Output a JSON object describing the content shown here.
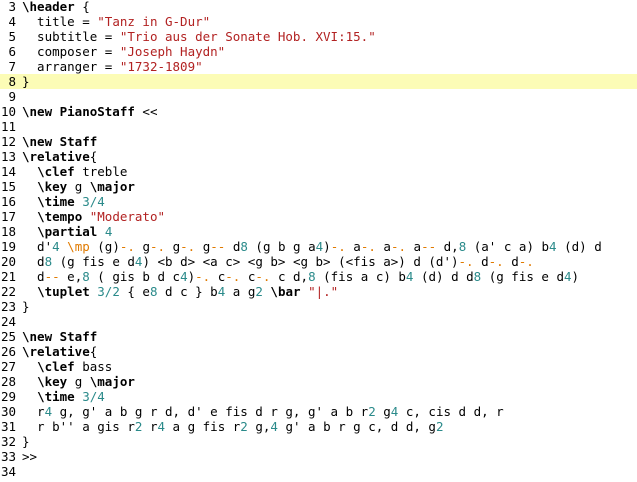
{
  "editor": {
    "lines": [
      {
        "n": "3",
        "current": false,
        "tokens": [
          {
            "t": "kw",
            "v": "\\header"
          },
          {
            "t": "plain",
            "v": " {"
          }
        ]
      },
      {
        "n": "4",
        "current": false,
        "tokens": [
          {
            "t": "plain",
            "v": "  title = "
          },
          {
            "t": "str",
            "v": "\"Tanz in G-Dur\""
          }
        ]
      },
      {
        "n": "5",
        "current": false,
        "tokens": [
          {
            "t": "plain",
            "v": "  subtitle = "
          },
          {
            "t": "str",
            "v": "\"Trio aus der Sonate Hob. XVI:15.\""
          }
        ]
      },
      {
        "n": "6",
        "current": false,
        "tokens": [
          {
            "t": "plain",
            "v": "  composer = "
          },
          {
            "t": "str",
            "v": "\"Joseph Haydn\""
          }
        ]
      },
      {
        "n": "7",
        "current": false,
        "tokens": [
          {
            "t": "plain",
            "v": "  arranger = "
          },
          {
            "t": "str",
            "v": "\"1732-1809\""
          }
        ]
      },
      {
        "n": "8",
        "current": true,
        "tokens": [
          {
            "t": "plain",
            "v": "}"
          }
        ]
      },
      {
        "n": "9",
        "current": false,
        "tokens": []
      },
      {
        "n": "10",
        "current": false,
        "tokens": [
          {
            "t": "kw",
            "v": "\\new PianoStaff"
          },
          {
            "t": "plain",
            "v": " <<"
          }
        ]
      },
      {
        "n": "11",
        "current": false,
        "tokens": []
      },
      {
        "n": "12",
        "current": false,
        "tokens": [
          {
            "t": "kw",
            "v": "\\new Staff"
          }
        ]
      },
      {
        "n": "13",
        "current": false,
        "tokens": [
          {
            "t": "kw",
            "v": "\\relative"
          },
          {
            "t": "plain",
            "v": "{"
          }
        ]
      },
      {
        "n": "14",
        "current": false,
        "tokens": [
          {
            "t": "plain",
            "v": "  "
          },
          {
            "t": "kw",
            "v": "\\clef"
          },
          {
            "t": "plain",
            "v": " treble"
          }
        ]
      },
      {
        "n": "15",
        "current": false,
        "tokens": [
          {
            "t": "plain",
            "v": "  "
          },
          {
            "t": "kw",
            "v": "\\key"
          },
          {
            "t": "plain",
            "v": " g "
          },
          {
            "t": "kw",
            "v": "\\major"
          }
        ]
      },
      {
        "n": "16",
        "current": false,
        "tokens": [
          {
            "t": "plain",
            "v": "  "
          },
          {
            "t": "kw",
            "v": "\\time"
          },
          {
            "t": "plain",
            "v": " "
          },
          {
            "t": "num",
            "v": "3/4"
          }
        ]
      },
      {
        "n": "17",
        "current": false,
        "tokens": [
          {
            "t": "plain",
            "v": "  "
          },
          {
            "t": "kw",
            "v": "\\tempo"
          },
          {
            "t": "plain",
            "v": " "
          },
          {
            "t": "str",
            "v": "\"Moderato\""
          }
        ]
      },
      {
        "n": "18",
        "current": false,
        "tokens": [
          {
            "t": "plain",
            "v": "  "
          },
          {
            "t": "kw",
            "v": "\\partial"
          },
          {
            "t": "plain",
            "v": " "
          },
          {
            "t": "num",
            "v": "4"
          }
        ]
      },
      {
        "n": "19",
        "current": false,
        "tokens": [
          {
            "t": "plain",
            "v": "  d'"
          },
          {
            "t": "dur",
            "v": "4"
          },
          {
            "t": "plain",
            "v": " "
          },
          {
            "t": "dyn",
            "v": "\\mp"
          },
          {
            "t": "plain",
            "v": " (g)"
          },
          {
            "t": "art",
            "v": "-."
          },
          {
            "t": "plain",
            "v": " g"
          },
          {
            "t": "art",
            "v": "-."
          },
          {
            "t": "plain",
            "v": " g"
          },
          {
            "t": "art",
            "v": "-."
          },
          {
            "t": "plain",
            "v": " g"
          },
          {
            "t": "art",
            "v": "--"
          },
          {
            "t": "plain",
            "v": " d"
          },
          {
            "t": "dur",
            "v": "8"
          },
          {
            "t": "plain",
            "v": " (g b g a"
          },
          {
            "t": "dur",
            "v": "4"
          },
          {
            "t": "plain",
            "v": ")"
          },
          {
            "t": "art",
            "v": "-."
          },
          {
            "t": "plain",
            "v": " a"
          },
          {
            "t": "art",
            "v": "-."
          },
          {
            "t": "plain",
            "v": " a"
          },
          {
            "t": "art",
            "v": "-."
          },
          {
            "t": "plain",
            "v": " a"
          },
          {
            "t": "art",
            "v": "--"
          },
          {
            "t": "plain",
            "v": " d,"
          },
          {
            "t": "dur",
            "v": "8"
          },
          {
            "t": "plain",
            "v": " (a' c a) b"
          },
          {
            "t": "dur",
            "v": "4"
          },
          {
            "t": "plain",
            "v": " (d) d"
          }
        ]
      },
      {
        "n": "20",
        "current": false,
        "tokens": [
          {
            "t": "plain",
            "v": "  d"
          },
          {
            "t": "dur",
            "v": "8"
          },
          {
            "t": "plain",
            "v": " (g fis e d"
          },
          {
            "t": "dur",
            "v": "4"
          },
          {
            "t": "plain",
            "v": ") <b d> <a c> <g b> <g b> (<fis a>) d (d')"
          },
          {
            "t": "art",
            "v": "-."
          },
          {
            "t": "plain",
            "v": " d"
          },
          {
            "t": "art",
            "v": "-."
          },
          {
            "t": "plain",
            "v": " d"
          },
          {
            "t": "art",
            "v": "-."
          }
        ]
      },
      {
        "n": "21",
        "current": false,
        "tokens": [
          {
            "t": "plain",
            "v": "  d"
          },
          {
            "t": "art",
            "v": "--"
          },
          {
            "t": "plain",
            "v": " e,"
          },
          {
            "t": "dur",
            "v": "8"
          },
          {
            "t": "plain",
            "v": " ( gis b d c"
          },
          {
            "t": "dur",
            "v": "4"
          },
          {
            "t": "plain",
            "v": ")"
          },
          {
            "t": "art",
            "v": "-."
          },
          {
            "t": "plain",
            "v": " c"
          },
          {
            "t": "art",
            "v": "-."
          },
          {
            "t": "plain",
            "v": " c"
          },
          {
            "t": "art",
            "v": "-."
          },
          {
            "t": "plain",
            "v": " c d,"
          },
          {
            "t": "dur",
            "v": "8"
          },
          {
            "t": "plain",
            "v": " (fis a c) b"
          },
          {
            "t": "dur",
            "v": "4"
          },
          {
            "t": "plain",
            "v": " (d) d d"
          },
          {
            "t": "dur",
            "v": "8"
          },
          {
            "t": "plain",
            "v": " (g fis e d"
          },
          {
            "t": "dur",
            "v": "4"
          },
          {
            "t": "plain",
            "v": ")"
          }
        ]
      },
      {
        "n": "22",
        "current": false,
        "tokens": [
          {
            "t": "plain",
            "v": "  "
          },
          {
            "t": "kw",
            "v": "\\tuplet"
          },
          {
            "t": "plain",
            "v": " "
          },
          {
            "t": "num",
            "v": "3/2"
          },
          {
            "t": "plain",
            "v": " { e"
          },
          {
            "t": "dur",
            "v": "8"
          },
          {
            "t": "plain",
            "v": " d c } b"
          },
          {
            "t": "dur",
            "v": "4"
          },
          {
            "t": "plain",
            "v": " a g"
          },
          {
            "t": "dur",
            "v": "2"
          },
          {
            "t": "plain",
            "v": " "
          },
          {
            "t": "kw",
            "v": "\\bar"
          },
          {
            "t": "plain",
            "v": " "
          },
          {
            "t": "str",
            "v": "\"|.\""
          }
        ]
      },
      {
        "n": "23",
        "current": false,
        "tokens": [
          {
            "t": "plain",
            "v": "}"
          }
        ]
      },
      {
        "n": "24",
        "current": false,
        "tokens": []
      },
      {
        "n": "25",
        "current": false,
        "tokens": [
          {
            "t": "kw",
            "v": "\\new Staff"
          }
        ]
      },
      {
        "n": "26",
        "current": false,
        "tokens": [
          {
            "t": "kw",
            "v": "\\relative"
          },
          {
            "t": "plain",
            "v": "{"
          }
        ]
      },
      {
        "n": "27",
        "current": false,
        "tokens": [
          {
            "t": "plain",
            "v": "  "
          },
          {
            "t": "kw",
            "v": "\\clef"
          },
          {
            "t": "plain",
            "v": " bass"
          }
        ]
      },
      {
        "n": "28",
        "current": false,
        "tokens": [
          {
            "t": "plain",
            "v": "  "
          },
          {
            "t": "kw",
            "v": "\\key"
          },
          {
            "t": "plain",
            "v": " g "
          },
          {
            "t": "kw",
            "v": "\\major"
          }
        ]
      },
      {
        "n": "29",
        "current": false,
        "tokens": [
          {
            "t": "plain",
            "v": "  "
          },
          {
            "t": "kw",
            "v": "\\time"
          },
          {
            "t": "plain",
            "v": " "
          },
          {
            "t": "num",
            "v": "3/4"
          }
        ]
      },
      {
        "n": "30",
        "current": false,
        "tokens": [
          {
            "t": "plain",
            "v": "  r"
          },
          {
            "t": "dur",
            "v": "4"
          },
          {
            "t": "plain",
            "v": " g, g' a b g r d, d' e fis d r g, g' a b r"
          },
          {
            "t": "dur",
            "v": "2"
          },
          {
            "t": "plain",
            "v": " g"
          },
          {
            "t": "dur",
            "v": "4"
          },
          {
            "t": "plain",
            "v": " c, cis d d, r"
          }
        ]
      },
      {
        "n": "31",
        "current": false,
        "tokens": [
          {
            "t": "plain",
            "v": "  r b'' a gis r"
          },
          {
            "t": "dur",
            "v": "2"
          },
          {
            "t": "plain",
            "v": " r"
          },
          {
            "t": "dur",
            "v": "4"
          },
          {
            "t": "plain",
            "v": " a g fis r"
          },
          {
            "t": "dur",
            "v": "2"
          },
          {
            "t": "plain",
            "v": " g,"
          },
          {
            "t": "dur",
            "v": "4"
          },
          {
            "t": "plain",
            "v": " g' a b r g c, d d, g"
          },
          {
            "t": "dur",
            "v": "2"
          }
        ]
      },
      {
        "n": "32",
        "current": false,
        "tokens": [
          {
            "t": "plain",
            "v": "}"
          }
        ]
      },
      {
        "n": "33",
        "current": false,
        "tokens": [
          {
            "t": "plain",
            "v": ">>"
          }
        ]
      },
      {
        "n": "34",
        "current": false,
        "tokens": []
      }
    ]
  }
}
